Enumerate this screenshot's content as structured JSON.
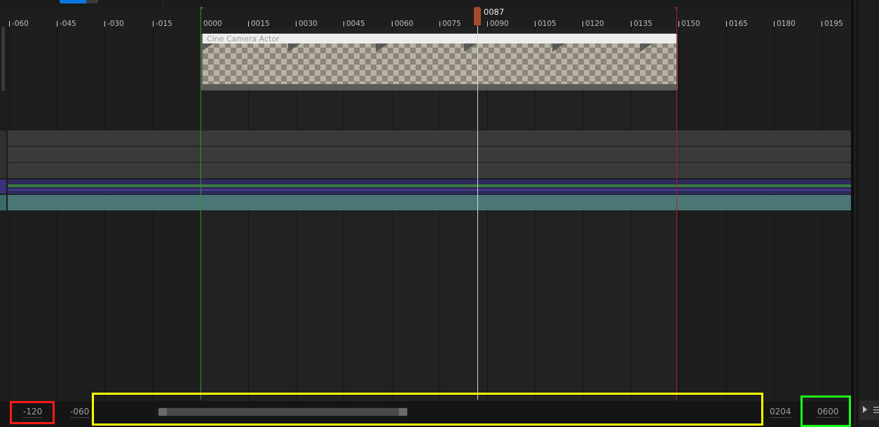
{
  "ruler": {
    "ticks": [
      "-060",
      "-045",
      "-030",
      "-015",
      "0000",
      "0015",
      "0030",
      "0045",
      "0060",
      "0075",
      "0090",
      "0105",
      "0120",
      "0135",
      "0150",
      "0165",
      "0180",
      "0195"
    ]
  },
  "playhead": {
    "frame": "0087"
  },
  "section": {
    "label": "Cine Camera Actor"
  },
  "bottom": {
    "view_start": "-120",
    "working_start": "-060",
    "working_end": "0204",
    "view_end": "0600"
  },
  "colors": {
    "playhead": "#a64a32",
    "start_marker": "#2f8f2f",
    "end_marker": "#a02727",
    "highlight_red": "#ff1a1a",
    "highlight_yellow": "#ffff00",
    "highlight_green": "#1aff1a"
  }
}
